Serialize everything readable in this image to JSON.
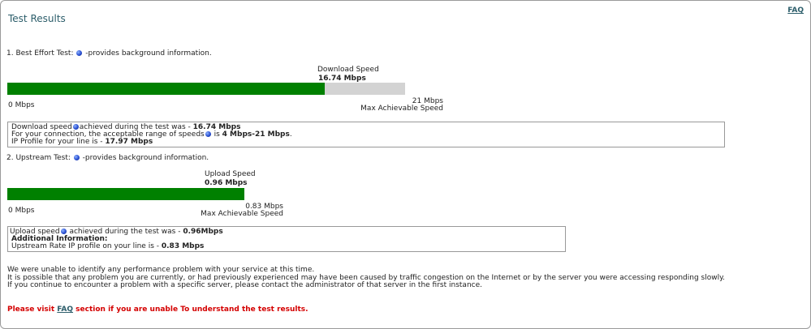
{
  "header": {
    "title": "Test Results",
    "faq_link": "FAQ"
  },
  "best_effort": {
    "heading": "1. Best Effort Test:",
    "info_suffix": "-provides background information.",
    "speed_label": "Download  Speed",
    "speed_value": "16.74 Mbps",
    "min_label": "0 Mbps",
    "max_value": "21 Mbps",
    "max_label": "Max Achievable Speed",
    "fill_fraction": 0.797,
    "bar_color": "#008000",
    "track_color": "#d3d3d3",
    "details": {
      "line1_prefix": "Download speed",
      "line1_middle": "achieved during the test was - ",
      "line1_value": "16.74 Mbps",
      "line2_prefix": "For your connection, the acceptable range of speeds",
      "line2_middle": " is ",
      "line2_value": "4 Mbps-21 Mbps",
      "line2_suffix": ".",
      "line3_prefix": "IP Profile for your line is - ",
      "line3_value": "17.97 Mbps"
    }
  },
  "upstream": {
    "heading": "2. Upstream Test:",
    "info_suffix": "-provides background information.",
    "speed_label": "Upload Speed",
    "speed_value": "0.96 Mbps",
    "min_label": "0 Mbps",
    "max_value": "0.83 Mbps",
    "max_label": "Max Achievable Speed",
    "fill_fraction": 1.0,
    "bar_color": "#008000",
    "details": {
      "line1_prefix": "Upload speed",
      "line1_middle": " achieved during the test was - ",
      "line1_value": "0.96Mbps",
      "line2_heading": "Additional Information:",
      "line3_prefix": "Upstream Rate IP profile on your line is - ",
      "line3_value": "0.83 Mbps"
    }
  },
  "summary": {
    "line1": "We were unable to identify any performance problem with your service at this time.",
    "line2": "It is possible that any problem you are currently, or had previously experienced may have been caused by traffic congestion on the Internet or by the server you were accessing responding slowly.",
    "line3": "If you continue to encounter a problem with a specific server, please contact the administrator of that server in the first instance."
  },
  "footer": {
    "prefix": "Please visit ",
    "link": "FAQ",
    "suffix": " section if you are unable To understand the test results."
  },
  "icons": {
    "info": "info-icon"
  }
}
